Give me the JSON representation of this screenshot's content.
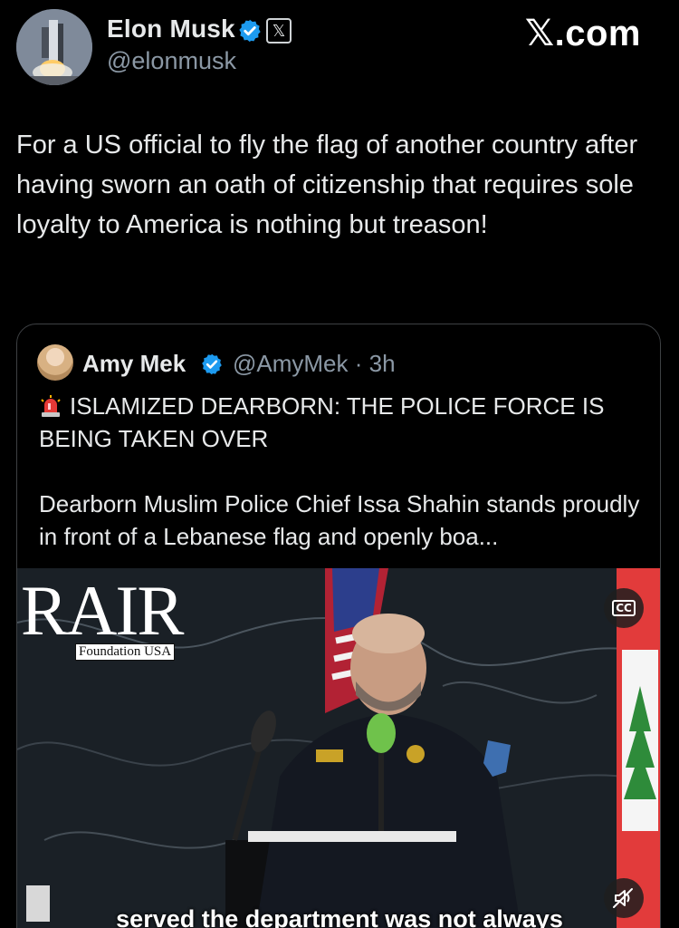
{
  "header": {
    "author_name": "Elon Musk",
    "author_handle": "@elonmusk",
    "x_badge": "𝕏",
    "site_logo": "𝕏.com",
    "verified_icon": "verified-badge-icon",
    "accent_color": "#1d9bf0"
  },
  "tweet": {
    "text": "For a US official to fly the flag of another country after having sworn an oath of citizenship that requires sole loyalty to America is nothing but treason!"
  },
  "quote": {
    "author_name": "Amy Mek",
    "author_handle": "@AmyMek · 3h",
    "line1": "ISLAMIZED DEARBORN: THE POLICE FORCE IS BEING TAKEN OVER",
    "line2": "Dearborn Muslim Police Chief Issa Shahin stands proudly in front of a Lebanese flag and openly boa...",
    "siren_icon": "police-siren-icon"
  },
  "video": {
    "logo_main": "RAIR",
    "logo_sub": "Foundation USA",
    "cc_label": "CC",
    "subtitle": "served the department was not always"
  }
}
